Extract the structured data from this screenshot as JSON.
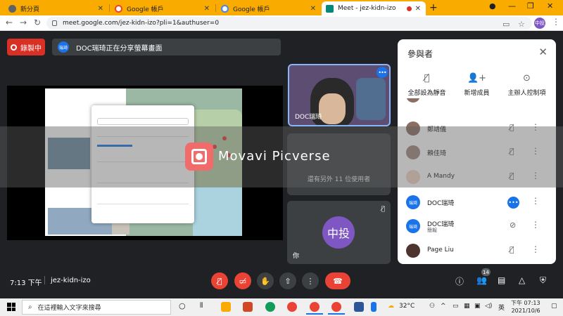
{
  "browser": {
    "tabs": [
      {
        "label": "新分頁"
      },
      {
        "label": "Google 帳戶"
      },
      {
        "label": "Google 帳戶"
      },
      {
        "label": "Meet - jez-kidn-izo"
      }
    ],
    "url": "meet.google.com/jez-kidn-izo?pli=1&authuser=0",
    "profile_initials": "中投"
  },
  "meet": {
    "recording_label": "錄製中",
    "presenting_banner": "DOC瑞琦正在分享螢幕畫面",
    "presenter_avatar": "瑞琦",
    "tiles": {
      "self_cam_name": "DOC瑞琦",
      "others_label": "還有另外 11 位使用者",
      "you_avatar": "中投",
      "you_label": "你"
    },
    "time": "7:13 下午",
    "meeting_code": "jez-kidn-izo",
    "participant_count": "14",
    "watermark_text": "Movavi Picverse"
  },
  "panel": {
    "title": "參與者",
    "actions": [
      {
        "label": "全部設為靜音"
      },
      {
        "label": "新增成員"
      },
      {
        "label": "主辦人控制項"
      }
    ],
    "participants": [
      {
        "name": "鄭靖儀",
        "sub": "",
        "avatar": ""
      },
      {
        "name": "賴佳琦",
        "sub": "",
        "avatar": ""
      },
      {
        "name": "A Mandy",
        "sub": "",
        "avatar": ""
      },
      {
        "name": "DOC瑞琦",
        "sub": "",
        "avatar": "瑞琦"
      },
      {
        "name": "DOC瑞琦",
        "sub": "簡報",
        "avatar": "瑞琦"
      },
      {
        "name": "Page Liu",
        "sub": "",
        "avatar": ""
      }
    ]
  },
  "taskbar": {
    "search_placeholder": "在這裡輸入文字來搜尋",
    "temperature": "32°C",
    "time": "下午 07:13",
    "date": "2021/10/6"
  }
}
